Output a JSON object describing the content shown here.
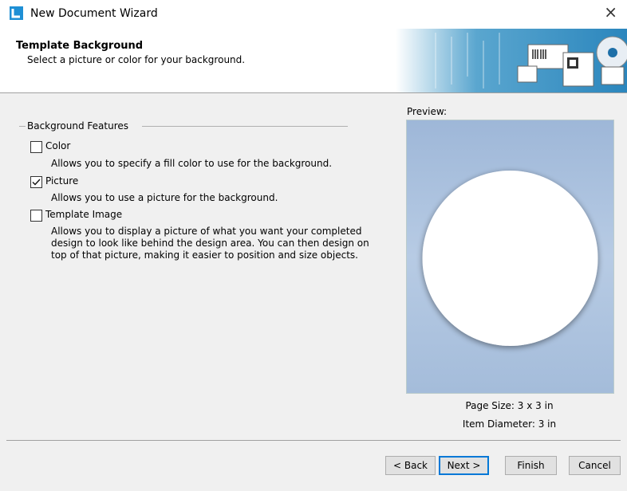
{
  "window": {
    "title": "New Document Wizard"
  },
  "header": {
    "title": "Template Background",
    "subtitle": "Select a picture or color for your background."
  },
  "group": {
    "legend": "Background Features",
    "options": [
      {
        "label": "Color",
        "checked": false,
        "description": "Allows you to specify a fill color to use for the background."
      },
      {
        "label": "Picture",
        "checked": true,
        "description": "Allows you to use a picture for the background."
      },
      {
        "label": "Template Image",
        "checked": false,
        "description": "Allows you to display a picture of what you want your completed design to look like behind the design area. You can then design on top of that picture, making it easier to position and size objects."
      }
    ]
  },
  "preview": {
    "label": "Preview:",
    "page_size": "Page Size:  3 x 3 in",
    "item_diameter": "Item Diameter:  3 in"
  },
  "buttons": {
    "back": "< Back",
    "next": "Next >",
    "finish": "Finish",
    "cancel": "Cancel"
  }
}
